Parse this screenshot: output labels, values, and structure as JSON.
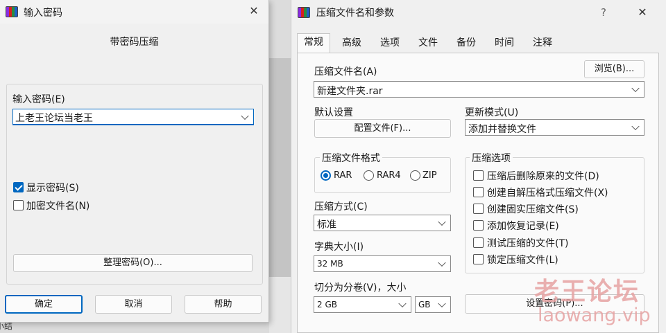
{
  "bg_fragment": "小结",
  "pwd_dialog": {
    "title": "输入密码",
    "close": "✕",
    "heading": "带密码压缩",
    "password_label": "输入密码(E)",
    "password_value": "上老王论坛当老王",
    "show_password_label": "显示密码(S)",
    "show_password_checked": true,
    "encrypt_names_label": "加密文件名(N)",
    "encrypt_names_checked": false,
    "organize_button": "整理密码(O)...",
    "ok_button": "确定",
    "cancel_button": "取消",
    "help_button": "帮助"
  },
  "main_dialog": {
    "title": "压缩文件名和参数",
    "help": "?",
    "close": "✕",
    "tabs": [
      "常规",
      "高级",
      "选项",
      "文件",
      "备份",
      "时间",
      "注释"
    ],
    "active_tab": "常规",
    "archive_name_label": "压缩文件名(A)",
    "browse_button": "浏览(B)...",
    "archive_name_value": "新建文件夹.rar",
    "default_settings_label": "默认设置",
    "profiles_button": "配置文件(F)...",
    "update_mode_label": "更新模式(U)",
    "update_mode_value": "添加并替换文件",
    "format_group_label": "压缩文件格式",
    "formats": [
      "RAR",
      "RAR4",
      "ZIP"
    ],
    "format_selected": "RAR",
    "options_group_label": "压缩选项",
    "options": [
      {
        "label": "压缩后删除原来的文件(D)",
        "checked": false
      },
      {
        "label": "创建自解压格式压缩文件(X)",
        "checked": false
      },
      {
        "label": "创建固实压缩文件(S)",
        "checked": false
      },
      {
        "label": "添加恢复记录(E)",
        "checked": false
      },
      {
        "label": "测试压缩的文件(T)",
        "checked": false
      },
      {
        "label": "锁定压缩文件(L)",
        "checked": false
      }
    ],
    "method_label": "压缩方式(C)",
    "method_value": "标准",
    "dict_label": "字典大小(I)",
    "dict_value": "32 MB",
    "split_label": "切分为分卷(V)，大小",
    "split_value": "2 GB",
    "split_unit": "GB",
    "set_password_button": "设置密码(P)..."
  },
  "watermark": {
    "line1": "老王论坛",
    "line2": "laowang.vip"
  },
  "colors": {
    "accent": "#0067c0",
    "watermark": "#e7a3a3"
  }
}
